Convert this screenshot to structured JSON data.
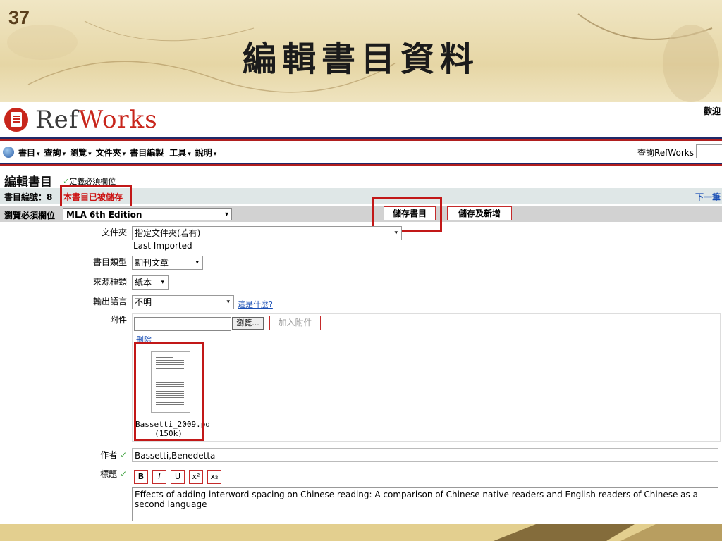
{
  "slide": {
    "number": "37",
    "title": "編輯書目資料"
  },
  "app": {
    "brand_ref": "Ref",
    "brand_works": "Works",
    "welcome": "歡迎",
    "search_label": "查詢RefWorks"
  },
  "menu": [
    {
      "label": "書目",
      "caret": "▾"
    },
    {
      "label": "查詢",
      "caret": "▾"
    },
    {
      "label": "瀏覽",
      "caret": "▾"
    },
    {
      "label": "文件夾",
      "caret": "▾"
    },
    {
      "label": "書目編製",
      "caret": ""
    },
    {
      "label": "工具",
      "caret": "▾"
    },
    {
      "label": "說明",
      "caret": "▾"
    }
  ],
  "editor": {
    "heading": "編輯書目",
    "required_note": "定義必須欄位",
    "ref_id_label": "書目編號：8",
    "saved_status": "本書目已被儲存",
    "next_link": "下一筆",
    "view_required_label": "瀏覽必須欄位",
    "output_style": "MLA 6th Edition",
    "save_button": "儲存書目",
    "save_new_button": "儲存及新增"
  },
  "fields": {
    "folder_label": "文件夾",
    "folder_value": "指定文件夾(若有)",
    "folder_current": "Last Imported",
    "ref_type_label": "書目類型",
    "ref_type_value": "期刊文章",
    "source_type_label": "來源種類",
    "source_type_value": "紙本",
    "language_label": "輸出語言",
    "language_value": "不明",
    "whats_this": "這是什麼?",
    "attachment_label": "附件",
    "browse_button": "瀏覽...",
    "add_attachment_button": "加入附件",
    "delete_link": "刪除",
    "file_name": "Bassetti_2009.pd",
    "file_size": "(150k)",
    "author_label": "作者",
    "author_value": "Bassetti,Benedetta",
    "title_label": "標題",
    "title_value": "Effects of adding interword spacing on Chinese reading: A comparison of Chinese native readers and English readers of Chinese as a second language"
  },
  "format_buttons": [
    "B",
    "I",
    "U",
    "x²",
    "x₂"
  ],
  "icons": {
    "check": "✓",
    "caret": "▾"
  },
  "colors": {
    "highlight": "#c21818",
    "brand_red": "#c8261c",
    "nav_blue": "#1f2a6a",
    "link": "#1a4fb5"
  }
}
